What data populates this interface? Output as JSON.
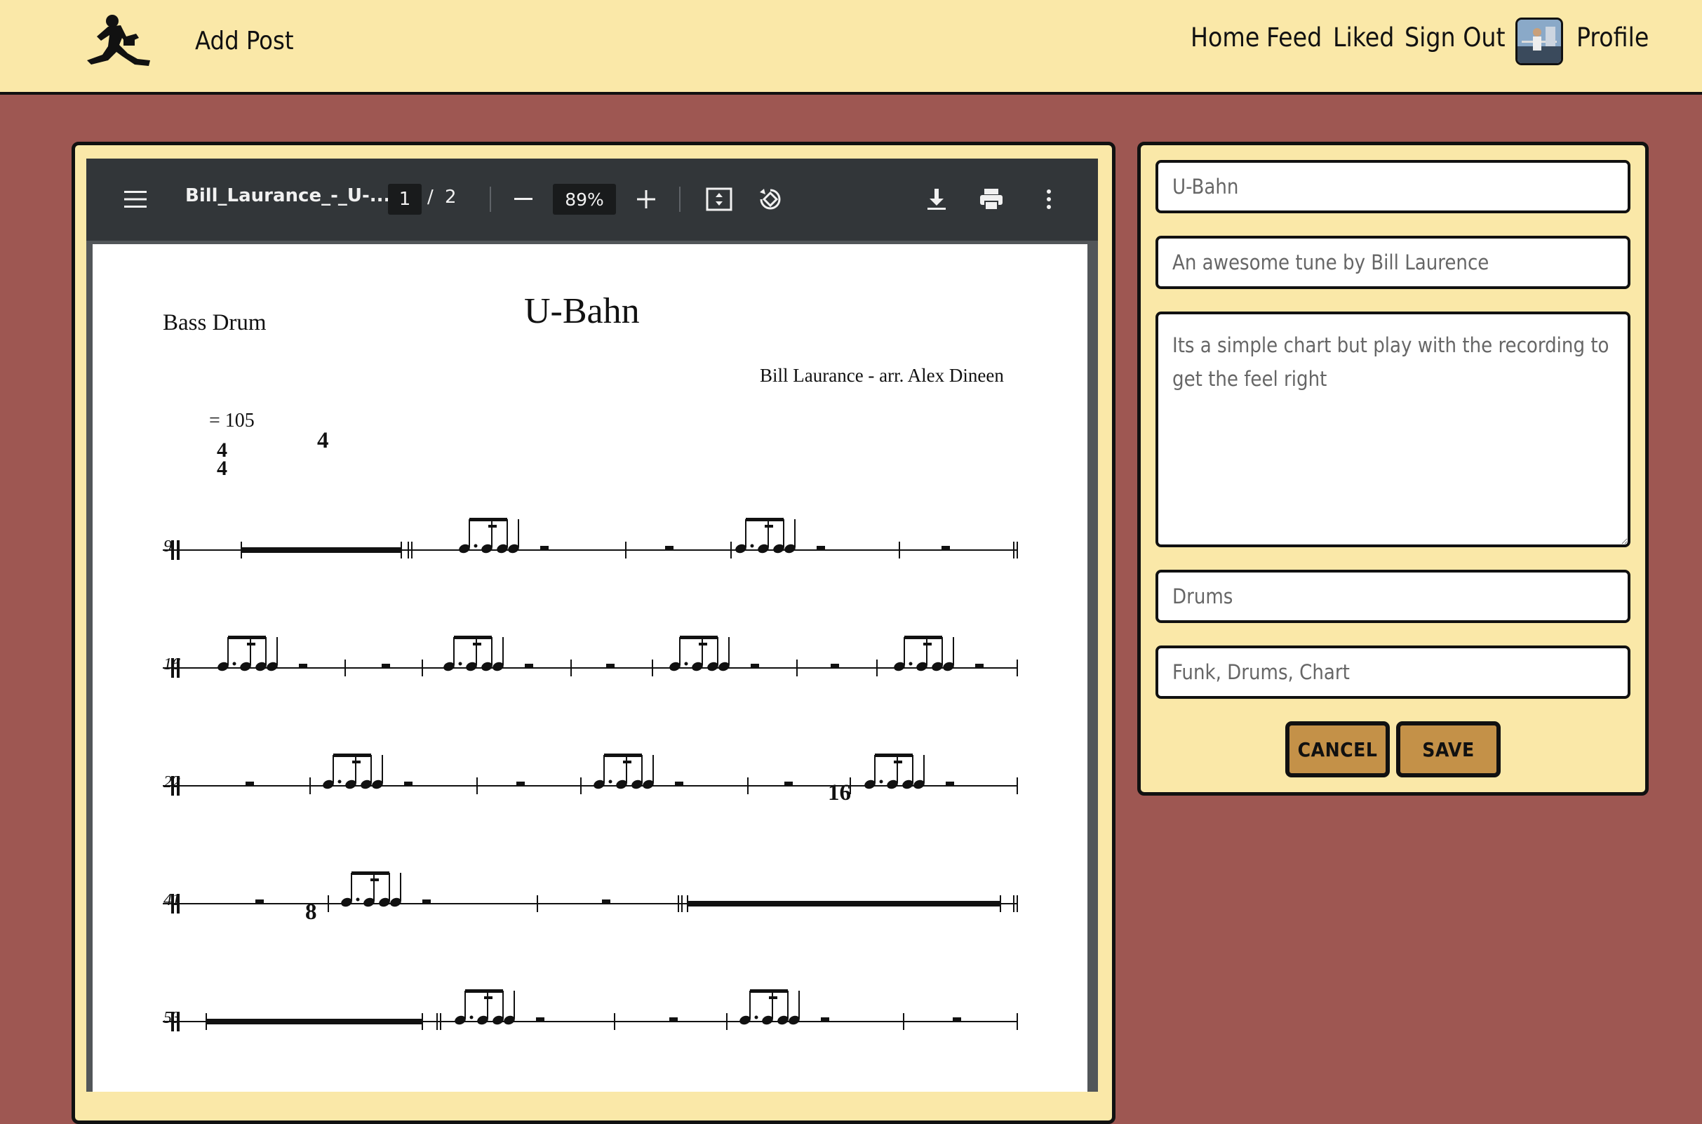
{
  "nav": {
    "title": "Add Post",
    "links": [
      "Home",
      "Feed",
      "Liked",
      "Sign Out"
    ],
    "profile_label": "Profile"
  },
  "pdf": {
    "filename": "Bill_Laurance_-_U-...",
    "current_page": "1",
    "page_separator": "/",
    "total_pages": "2",
    "zoom": "89%",
    "icons": [
      "menu-icon",
      "zoom-out-icon",
      "zoom-in-icon",
      "fit-page-icon",
      "rotate-icon",
      "download-icon",
      "print-icon",
      "more-icon"
    ]
  },
  "score": {
    "instrument": "Bass Drum",
    "title": "U-Bahn",
    "composer": "Bill Laurance - arr. Alex Dineen",
    "tempo": "= 105",
    "time_signature_top": "4",
    "time_signature_bottom": "4",
    "measure_numbers": [
      "9",
      "16",
      "22",
      "41",
      "53"
    ],
    "rest_counts": [
      "4",
      "16",
      "8"
    ]
  },
  "form": {
    "title_value": "U-Bahn",
    "description_value": "An awesome tune by Bill Laurence",
    "notes_value": "Its a simple chart but play with the recording to get the feel right",
    "instrument_value": "Drums",
    "tags_value": "Funk, Drums, Chart",
    "cancel_label": "CANCEL",
    "save_label": "SAVE"
  }
}
